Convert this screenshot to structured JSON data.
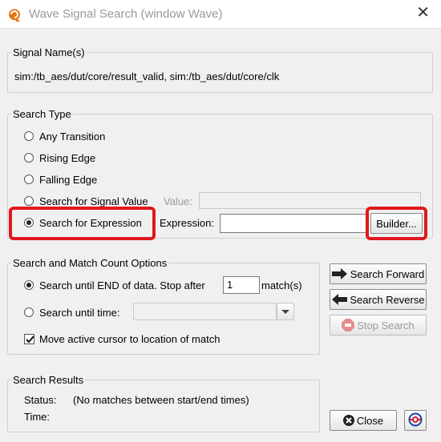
{
  "window": {
    "title": "Wave Signal Search (window Wave)"
  },
  "signal_names": {
    "legend": "Signal Name(s)",
    "value": "sim:/tb_aes/dut/core/result_valid, sim:/tb_aes/dut/core/clk"
  },
  "search_type": {
    "legend": "Search Type",
    "options": [
      "Any Transition",
      "Rising Edge",
      "Falling Edge",
      "Search for Signal Value",
      "Search for Expression"
    ],
    "selected": "Search for Expression",
    "value_label": "Value:",
    "value_field": "",
    "expression_label": "Expression:",
    "expression_field": "",
    "builder_label": "Builder..."
  },
  "options": {
    "legend": "Search and Match Count Options",
    "until_end_label": "Search until END of data.  Stop after",
    "match_count": "1",
    "match_suffix": "match(s)",
    "until_time_label": "Search until time:",
    "time_value": "",
    "move_cursor_label": "Move active cursor to location of match",
    "move_cursor_checked": true
  },
  "actions": {
    "search_forward": "Search Forward",
    "search_reverse": "Search Reverse",
    "stop_search": "Stop Search",
    "close": "Close"
  },
  "results": {
    "legend": "Search Results",
    "status_label": "Status:",
    "status_value": "(No matches between start/end times)",
    "time_label": "Time:",
    "time_value": ""
  }
}
